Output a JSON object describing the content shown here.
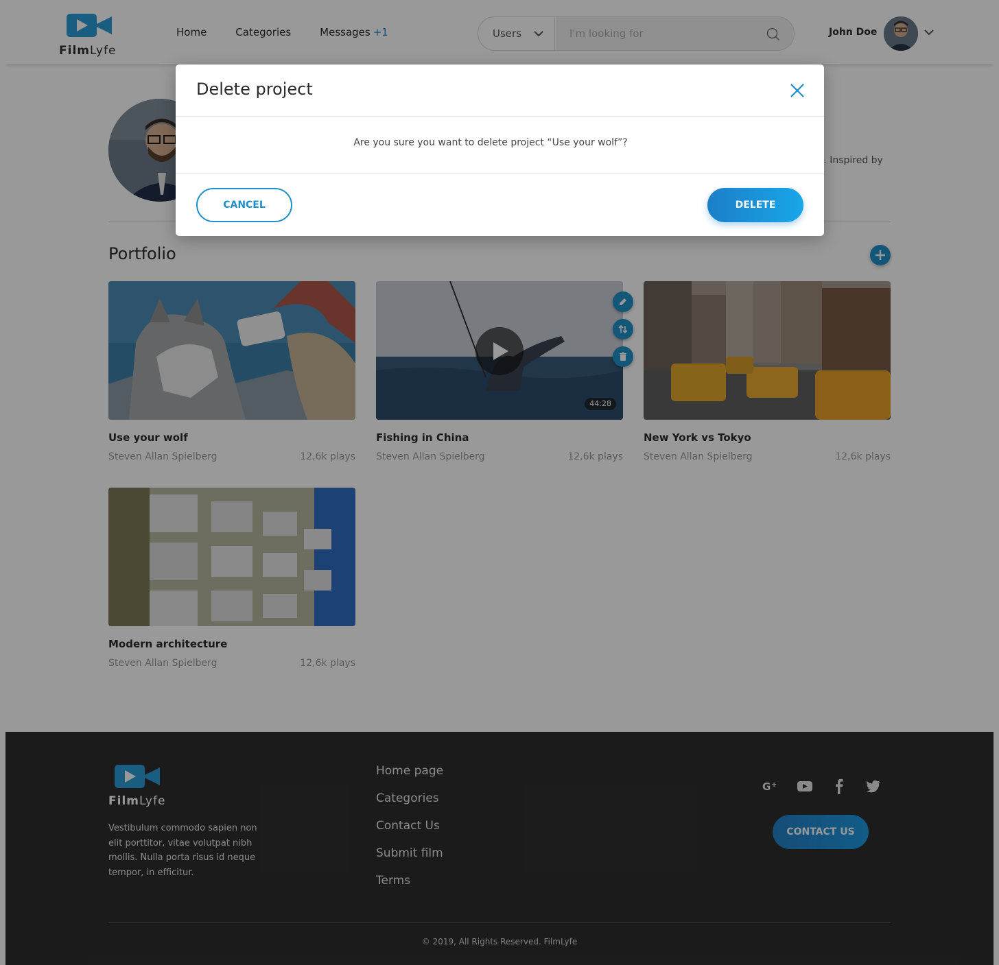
{
  "brand": {
    "name_bold": "Film",
    "name_light": "Lyfe",
    "color": "#2a9bd8"
  },
  "nav": {
    "home": "Home",
    "categories": "Categories",
    "messages": "Messages",
    "messages_badge": "+1"
  },
  "search": {
    "select_value": "Users",
    "placeholder": "I'm looking for"
  },
  "user": {
    "name": "John Doe"
  },
  "profile": {
    "bio_fragment": "s. Inspired by"
  },
  "portfolio": {
    "title": "Portfolio",
    "items": [
      {
        "title": "Use your wolf",
        "author": "Steven Allan Spielberg",
        "plays": "12,6k plays"
      },
      {
        "title": "Fishing in China",
        "author": "Steven Allan Spielberg",
        "plays": "12,6k plays",
        "duration": "44:28"
      },
      {
        "title": "New York vs Tokyo",
        "author": "Steven Allan Spielberg",
        "plays": "12,6k plays"
      },
      {
        "title": "Modern architecture",
        "author": "Steven Allan Spielberg",
        "plays": "12,6k plays"
      }
    ]
  },
  "footer": {
    "description": "Vestibulum commodo sapien non elit porttitor, vitae volutpat nibh mollis. Nulla porta risus id neque tempor, in efficitur.",
    "links": [
      "Home page",
      "Categories",
      "Contact Us",
      "Submit film",
      "Terms"
    ],
    "social_icons": [
      "google-plus-icon",
      "youtube-icon",
      "facebook-icon",
      "twitter-icon"
    ],
    "contact_button": "CONTACT US",
    "copyright": "© 2019, All Rights Reserved. FilmLyfe"
  },
  "modal": {
    "title": "Delete project",
    "message": "Are you sure you want to delete project “Use your wolf”?",
    "cancel_label": "CANCEL",
    "delete_label": "DELETE"
  },
  "colors": {
    "accent": "#1f8fc9",
    "footer_bg": "#2e2e2e",
    "overlay": "rgba(0,0,0,0.40)"
  }
}
